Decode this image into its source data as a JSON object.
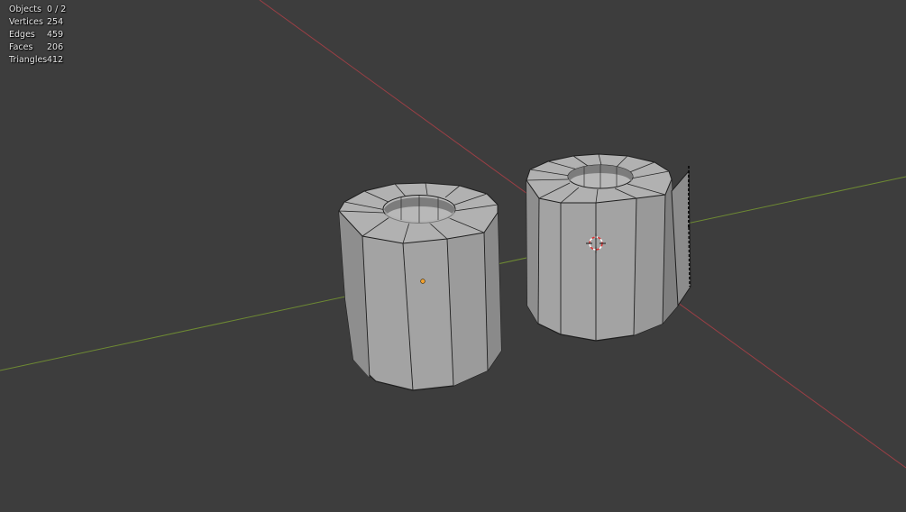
{
  "stats": {
    "rows": [
      {
        "label": "Objects",
        "value": "0 / 2"
      },
      {
        "label": "Vertices",
        "value": "254"
      },
      {
        "label": "Edges",
        "value": "459"
      },
      {
        "label": "Faces",
        "value": "206"
      },
      {
        "label": "Triangles",
        "value": "412"
      }
    ]
  },
  "colors": {
    "background": "#3d3d3d",
    "x_axis": "#9a3f45",
    "y_axis": "#6e8a33",
    "mesh_face": "#a3a3a3",
    "mesh_wire": "#202020",
    "origin": "#f0a030"
  }
}
